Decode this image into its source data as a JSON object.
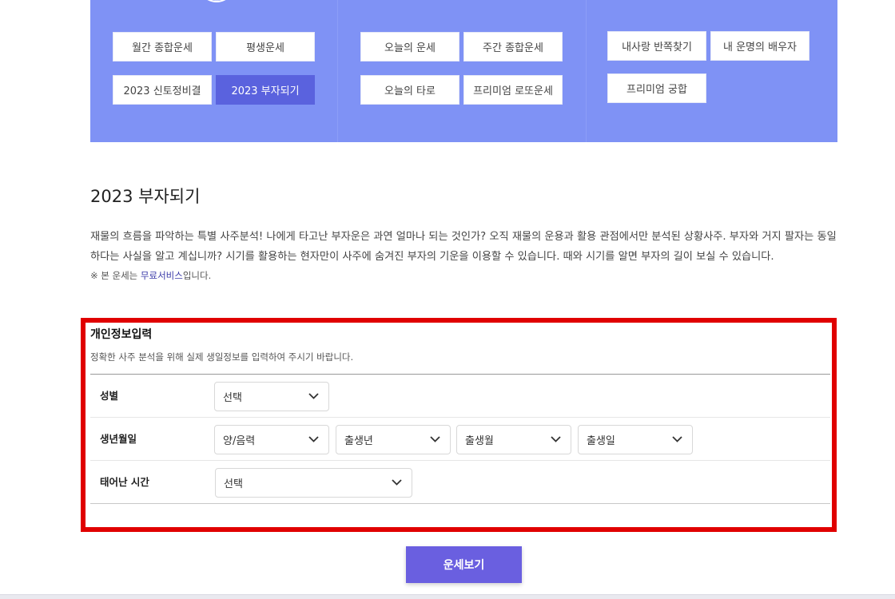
{
  "menu": {
    "col1": [
      "월간 종합운세",
      "평생운세",
      "2023 신토정비결",
      "2023 부자되기"
    ],
    "col2": [
      "오늘의 운세",
      "주간 종합운세",
      "오늘의 타로",
      "프리미엄 로또운세"
    ],
    "col3": [
      "내사랑 반쪽찾기",
      "내 운명의 배우자",
      "프리미엄 궁합"
    ],
    "active": "2023 부자되기"
  },
  "page": {
    "title": "2023 부자되기",
    "description": "재물의 흐름을 파악하는 특별 사주분석! 나에게 타고난 부자운은 과연 얼마나 되는 것인가? 오직 재물의 운용과 활용 관점에서만 분석된 상황사주. 부자와 거지 팔자는 동일하다는 사실을 알고 계십니까? 시기를 활용하는 현자만이 사주에 숨겨진 부자의 기운을 이용할 수 있습니다. 때와 시기를 알면 부자의 길이 보실 수 있습니다.",
    "note_prefix": "※ 본 운세는 ",
    "note_link": "무료서비스",
    "note_suffix": "입니다."
  },
  "form": {
    "title": "개인정보입력",
    "subtitle": "정확한 사주 분석을 위해 실제 생일정보를 입력하여 주시기 바랍니다.",
    "gender_label": "성별",
    "gender_value": "선택",
    "birth_label": "생년월일",
    "calendar_value": "양/음력",
    "year_value": "출생년",
    "month_value": "출생월",
    "day_value": "출생일",
    "time_label": "태어난 시간",
    "time_value": "선택"
  },
  "submit_label": "운세보기",
  "colors": {
    "menu_band": "#7f92f5",
    "active_button": "#5a62de",
    "highlight_frame": "#e00000",
    "submit_button": "#6a5fe0"
  }
}
